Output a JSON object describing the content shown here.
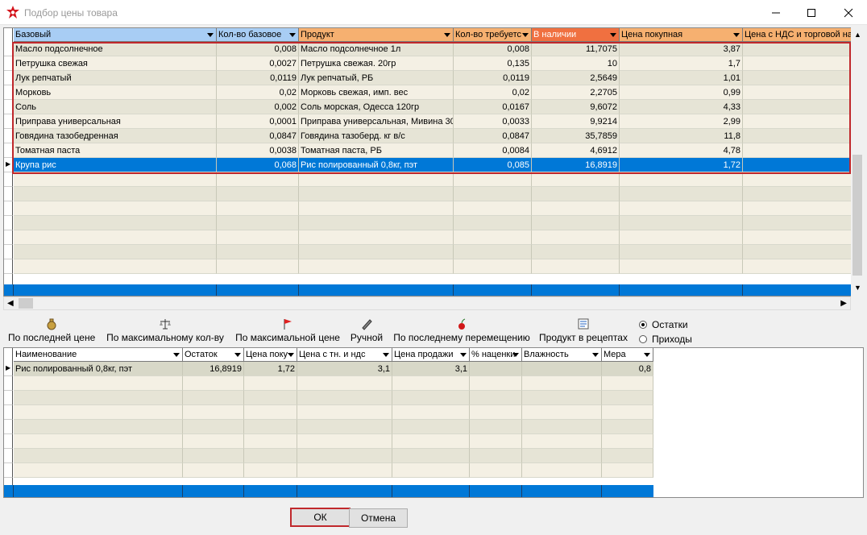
{
  "window": {
    "title": "Подбор цены товара"
  },
  "top_grid": {
    "columns": [
      "Базовый",
      "Кол-во базовое",
      "Продукт",
      "Кол-во требуетс",
      "В наличии",
      "Цена покупная",
      "Цена с НДС и торговой на"
    ],
    "rows": [
      [
        "Масло подсолнечное",
        "0,008",
        "Масло подсолнечное 1л",
        "0,008",
        "11,7075",
        "3,87",
        ""
      ],
      [
        "Петрушка свежая",
        "0,0027",
        "Петрушка свежая. 20гр",
        "0,135",
        "10",
        "1,7",
        ""
      ],
      [
        "Лук репчатый",
        "0,0119",
        "Лук репчатый, РБ",
        "0,0119",
        "2,5649",
        "1,01",
        ""
      ],
      [
        "Морковь",
        "0,02",
        "Морковь свежая, имп. вес",
        "0,02",
        "2,2705",
        "0,99",
        ""
      ],
      [
        "Соль",
        "0,002",
        "Соль морская, Одесса 120гр",
        "0,0167",
        "9,6072",
        "4,33",
        ""
      ],
      [
        "Приправа универсальная",
        "0,0001",
        "Приправа универсальная, Мивина 30",
        "0,0033",
        "9,9214",
        "2,99",
        ""
      ],
      [
        "Говядина тазобедренная",
        "0,0847",
        "Говядина тазоберд. кг в/с",
        "0,0847",
        "35,7859",
        "11,8",
        ""
      ],
      [
        "Томатная паста",
        "0,0038",
        "Томатная паста, РБ",
        "0,0084",
        "4,6912",
        "4,78",
        ""
      ],
      [
        "Крупа рис",
        "0,068",
        "Рис полированный 0,8кг, пэт",
        "0,085",
        "16,8919",
        "1,72",
        ""
      ]
    ],
    "selected_index": 8
  },
  "toolbar": {
    "by_last_price": "По последней цене",
    "by_max_qty": "По максимальному кол-ву",
    "by_max_price": "По максимальной цене",
    "manual": "Ручной",
    "by_last_move": "По последнему перемещению",
    "product_in_recipes": "Продукт в рецептах"
  },
  "radio": {
    "leftovers": "Остатки",
    "receipts": "Приходы",
    "selected": "Остатки"
  },
  "bottom_grid": {
    "columns": [
      "Наименование",
      "Остаток",
      "Цена поку",
      "Цена с тн. и ндс",
      "Цена продажи",
      "% наценки",
      "Влажность",
      "Мера"
    ],
    "rows": [
      [
        "Рис полированный 0,8кг, пэт",
        "16,8919",
        "1,72",
        "3,1",
        "3,1",
        "",
        "",
        "0,8"
      ]
    ]
  },
  "buttons": {
    "ok": "ОК",
    "cancel": "Отмена"
  },
  "colors": {
    "selection": "#0078d7",
    "highlight_border": "#c0282c",
    "row_odd": "#e6e4d6",
    "row_even": "#f4f0e4",
    "header_blue": "#a8cdf4",
    "header_orange": "#f6b070",
    "header_red": "#f07040"
  }
}
